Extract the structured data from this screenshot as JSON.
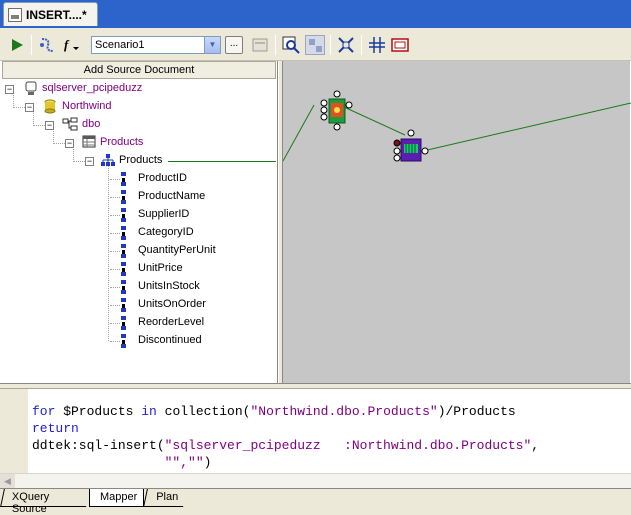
{
  "document_tab": {
    "title": "INSERT....*"
  },
  "toolbar": {
    "run_icon": "run-icon",
    "debug_icon": "step-icon",
    "function_icon": "function-icon",
    "scenario_value": "Scenario1",
    "dots_label": "...",
    "icons": [
      "run-icon",
      "step-icon",
      "function-icon",
      "browse-icon",
      "properties-icon",
      "find-icon",
      "grid-icon",
      "fit-icon",
      "align-icon",
      "preview-icon"
    ]
  },
  "tree": {
    "header": "Add Source Document",
    "server": "sqlserver_pcipeduzz",
    "database": "Northwind",
    "schema": "dbo",
    "table": "Products",
    "row": "Products",
    "fields": [
      "ProductID",
      "ProductName",
      "SupplierID",
      "CategoryID",
      "QuantityPerUnit",
      "UnitPrice",
      "UnitsInStock",
      "UnitsOnOrder",
      "ReorderLevel",
      "Discontinued"
    ]
  },
  "code": {
    "line1": {
      "kw1": "for",
      "var": " $Products ",
      "kw2": "in",
      "call": " collection(",
      "str": "\"Northwind.dbo.Products\"",
      "tail": ")/Products"
    },
    "line2": {
      "kw": "return"
    },
    "line3": {
      "call": "ddtek:sql-insert(",
      "str": "\"sqlserver_pcipeduzz   :Northwind.dbo.Products\"",
      "tail": ","
    },
    "line4": {
      "indent": "                 ",
      "str": "\"\",\"\"",
      "tail": ")"
    }
  },
  "bottom_tabs": [
    "XQuery Source",
    "Mapper",
    "Plan"
  ],
  "colors": {
    "accent": "#2c64cc",
    "keyword": "#1f1fd0",
    "string": "#800080",
    "link": "#1a7a1a"
  }
}
